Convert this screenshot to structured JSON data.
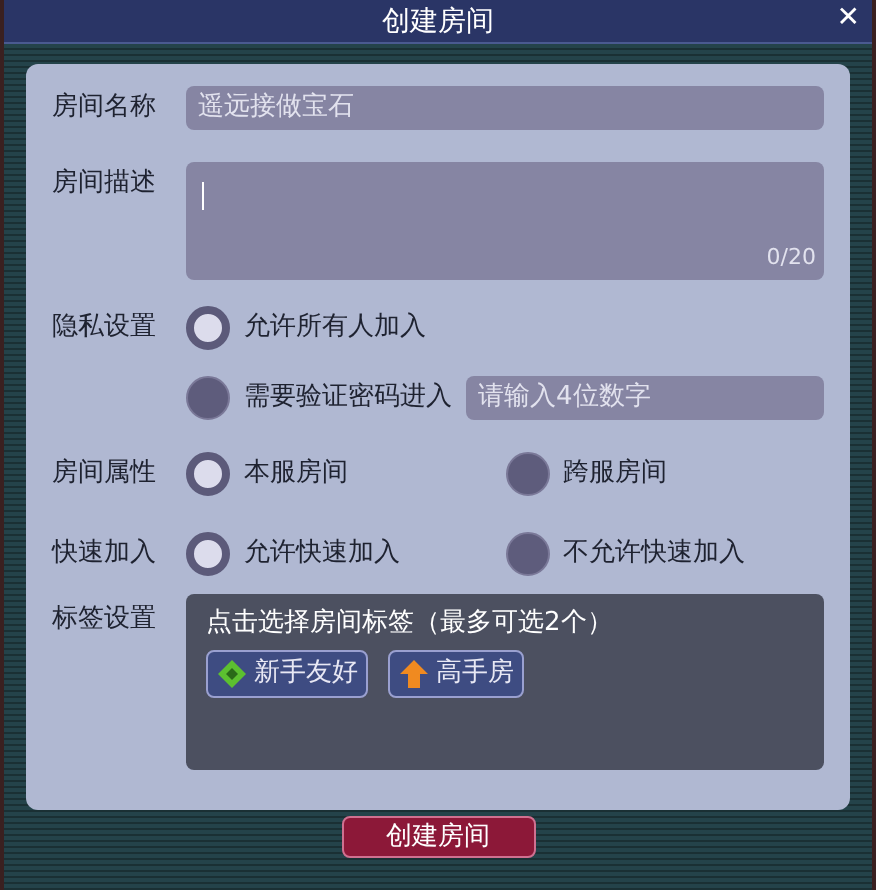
{
  "window": {
    "title": "创建房间",
    "close": "✕"
  },
  "name_field": {
    "label": "房间名称",
    "value": "遥远接做宝石"
  },
  "description_field": {
    "label": "房间描述",
    "counter": "0/20"
  },
  "privacy": {
    "label": "隐私设置",
    "options": [
      {
        "label": "允许所有人加入",
        "selected": true
      },
      {
        "label": "需要验证密码进入",
        "selected": false
      }
    ],
    "password_placeholder": "请输入4位数字"
  },
  "room_type": {
    "label": "房间属性",
    "options": [
      {
        "label": "本服房间",
        "selected": true
      },
      {
        "label": "跨服房间",
        "selected": false
      }
    ]
  },
  "quick_join": {
    "label": "快速加入",
    "options": [
      {
        "label": "允许快速加入",
        "selected": true
      },
      {
        "label": "不允许快速加入",
        "selected": false
      }
    ]
  },
  "tags": {
    "label": "标签设置",
    "hint": "点击选择房间标签（最多可选2个）",
    "items": [
      {
        "label": "新手友好",
        "kind": "diamond"
      },
      {
        "label": "高手房",
        "kind": "arrow"
      }
    ]
  },
  "create_button": "创建房间"
}
